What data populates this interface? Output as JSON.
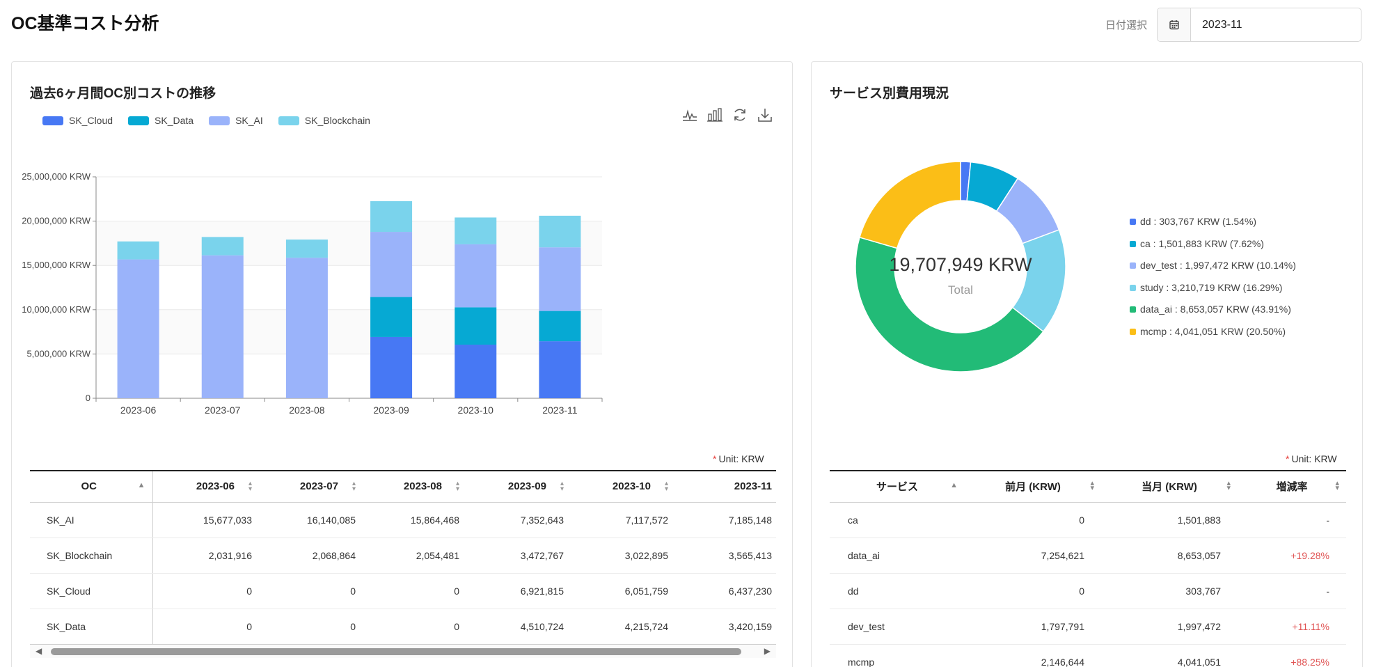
{
  "page": {
    "title": "OC基準コスト分析"
  },
  "date_picker": {
    "label": "日付選択",
    "value": "2023-11",
    "icon": "calendar-icon"
  },
  "colors": {
    "SK_Cloud": "#4778f4",
    "SK_Data": "#06a9d3",
    "SK_AI": "#9ab3fa",
    "SK_Blockchain": "#7ad3ec"
  },
  "left_card": {
    "title": "過去6ヶ月間OC別コストの推移",
    "toolbox": [
      "line-chart-icon",
      "bar-chart-icon",
      "refresh-icon",
      "download-icon"
    ],
    "unit_star": "*",
    "unit": "Unit: KRW",
    "table": {
      "columns": [
        "OC",
        "2023-06",
        "2023-07",
        "2023-08",
        "2023-09",
        "2023-10",
        "2023-11"
      ],
      "rows": [
        [
          "SK_AI",
          "15,677,033",
          "16,140,085",
          "15,864,468",
          "7,352,643",
          "7,117,572",
          "7,185,148"
        ],
        [
          "SK_Blockchain",
          "2,031,916",
          "2,068,864",
          "2,054,481",
          "3,472,767",
          "3,022,895",
          "3,565,413"
        ],
        [
          "SK_Cloud",
          "0",
          "0",
          "0",
          "6,921,815",
          "6,051,759",
          "6,437,230"
        ],
        [
          "SK_Data",
          "0",
          "0",
          "0",
          "4,510,724",
          "4,215,724",
          "3,420,159"
        ]
      ]
    }
  },
  "chart_data": [
    {
      "type": "bar",
      "stacked": true,
      "categories": [
        "2023-06",
        "2023-07",
        "2023-08",
        "2023-09",
        "2023-10",
        "2023-11"
      ],
      "series": [
        {
          "name": "SK_Cloud",
          "color": "#4778f4",
          "values": [
            0,
            0,
            0,
            6921815,
            6051759,
            6437230
          ]
        },
        {
          "name": "SK_Data",
          "color": "#06a9d3",
          "values": [
            0,
            0,
            0,
            4510724,
            4215724,
            3420159
          ]
        },
        {
          "name": "SK_AI",
          "color": "#9ab3fa",
          "values": [
            15677033,
            16140085,
            15864468,
            7352643,
            7117572,
            7185148
          ]
        },
        {
          "name": "SK_Blockchain",
          "color": "#7ad3ec",
          "values": [
            2031916,
            2068864,
            2054481,
            3472767,
            3022895,
            3565413
          ]
        }
      ],
      "ylim": [
        0,
        25000000
      ],
      "yticks": [
        "0",
        "5,000,000 KRW",
        "10,000,000 KRW",
        "15,000,000 KRW",
        "20,000,000 KRW",
        "25,000,000 KRW"
      ],
      "legend": "top-left",
      "grid": true
    },
    {
      "type": "pie",
      "donut": true,
      "center_value": "19,707,949 KRW",
      "center_label": "Total",
      "slices": [
        {
          "name": "dd",
          "value": 303767,
          "color": "#4778f4",
          "label": "dd : 303,767 KRW (1.54%)"
        },
        {
          "name": "ca",
          "value": 1501883,
          "color": "#06a9d3",
          "label": "ca : 1,501,883 KRW (7.62%)"
        },
        {
          "name": "dev_test",
          "value": 1997472,
          "color": "#9ab3fa",
          "label": "dev_test : 1,997,472 KRW (10.14%)"
        },
        {
          "name": "study",
          "value": 3210719,
          "color": "#7ad3ec",
          "label": "study : 3,210,719 KRW (16.29%)"
        },
        {
          "name": "data_ai",
          "value": 8653057,
          "color": "#22bb77",
          "label": "data_ai : 8,653,057 KRW (43.91%)"
        },
        {
          "name": "mcmp",
          "value": 4041051,
          "color": "#fbbe17",
          "label": "mcmp : 4,041,051 KRW (20.50%)"
        }
      ],
      "legend": "right"
    }
  ],
  "right_card": {
    "title": "サービス別費用現況",
    "unit_star": "*",
    "unit": "Unit: KRW",
    "table": {
      "columns": [
        "サービス",
        "前月 (KRW)",
        "当月 (KRW)",
        "増減率"
      ],
      "rows": [
        [
          "ca",
          "0",
          "1,501,883",
          "-"
        ],
        [
          "data_ai",
          "7,254,621",
          "8,653,057",
          "+19.28%"
        ],
        [
          "dd",
          "0",
          "303,767",
          "-"
        ],
        [
          "dev_test",
          "1,797,791",
          "1,997,472",
          "+11.11%"
        ],
        [
          "mcmp",
          "2,146,644",
          "4,041,051",
          "+88.25%"
        ]
      ]
    }
  }
}
